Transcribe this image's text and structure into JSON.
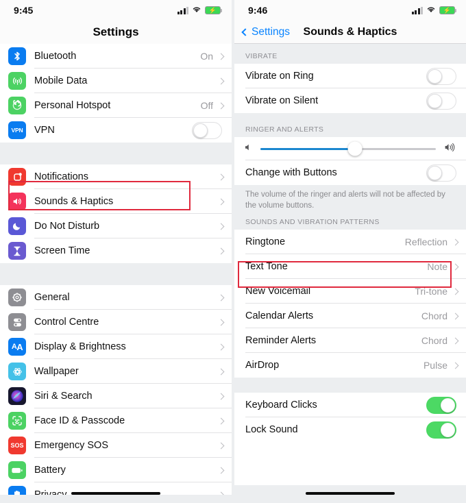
{
  "left": {
    "status": {
      "time": "9:45",
      "signal_icon": "cellular-signal-icon",
      "wifi_icon": "wifi-icon",
      "battery_icon": "battery-charging-icon"
    },
    "nav": {
      "title": "Settings"
    },
    "groups": [
      {
        "items": [
          {
            "label": "Bluetooth",
            "value": "On",
            "icon": "bluetooth-icon",
            "accessory": "chevron",
            "color": "#0a7cf0"
          },
          {
            "label": "Mobile Data",
            "value": "",
            "icon": "mobile-data-icon",
            "accessory": "chevron",
            "color": "#4cd263"
          },
          {
            "label": "Personal Hotspot",
            "value": "Off",
            "icon": "personal-hotspot-icon",
            "accessory": "chevron",
            "color": "#4cd263"
          },
          {
            "label": "VPN",
            "value": "",
            "icon": "vpn-icon",
            "accessory": "toggle",
            "toggle_on": false,
            "color": "#0a7cf0"
          }
        ]
      },
      {
        "items": [
          {
            "label": "Notifications",
            "value": "",
            "icon": "notifications-icon",
            "accessory": "chevron",
            "color": "#f0392f"
          },
          {
            "label": "Sounds & Haptics",
            "value": "",
            "icon": "sounds-haptics-icon",
            "accessory": "chevron",
            "color": "#f4335b"
          },
          {
            "label": "Do Not Disturb",
            "value": "",
            "icon": "do-not-disturb-icon",
            "accessory": "chevron",
            "color": "#5a58d6"
          },
          {
            "label": "Screen Time",
            "value": "",
            "icon": "screen-time-icon",
            "accessory": "chevron",
            "color": "#6a5ad0"
          }
        ]
      },
      {
        "items": [
          {
            "label": "General",
            "value": "",
            "icon": "general-gear-icon",
            "accessory": "chevron",
            "color": "#8e8e93"
          },
          {
            "label": "Control Centre",
            "value": "",
            "icon": "control-centre-icon",
            "accessory": "chevron",
            "color": "#8e8e93"
          },
          {
            "label": "Display & Brightness",
            "value": "",
            "icon": "display-brightness-icon",
            "accessory": "chevron",
            "color": "#0a7cf0"
          },
          {
            "label": "Wallpaper",
            "value": "",
            "icon": "wallpaper-icon",
            "accessory": "chevron",
            "color": "#44c1e8"
          },
          {
            "label": "Siri & Search",
            "value": "",
            "icon": "siri-search-icon",
            "accessory": "chevron",
            "color": "#1d1d38"
          },
          {
            "label": "Face ID & Passcode",
            "value": "",
            "icon": "face-id-icon",
            "accessory": "chevron",
            "color": "#4cd263"
          },
          {
            "label": "Emergency SOS",
            "value": "",
            "icon": "emergency-sos-icon",
            "accessory": "chevron",
            "color": "#f0392f"
          },
          {
            "label": "Battery",
            "value": "",
            "icon": "battery-settings-icon",
            "accessory": "chevron",
            "color": "#4cd263"
          },
          {
            "label": "Privacy",
            "value": "",
            "icon": "privacy-hand-icon",
            "accessory": "chevron",
            "color": "#0a7cf0"
          }
        ]
      }
    ],
    "highlight_target": "Sounds & Haptics"
  },
  "right": {
    "status": {
      "time": "9:46",
      "signal_icon": "cellular-signal-icon",
      "wifi_icon": "wifi-icon",
      "battery_icon": "battery-charging-icon"
    },
    "nav": {
      "back_label": "Settings",
      "title": "Sounds & Haptics",
      "back_icon": "chevron-left-icon"
    },
    "sections": [
      {
        "header": "VIBRATE",
        "rows": [
          {
            "label": "Vibrate on Ring",
            "type": "toggle",
            "on": false
          },
          {
            "label": "Vibrate on Silent",
            "type": "toggle",
            "on": false
          }
        ]
      },
      {
        "header": "RINGER AND ALERTS",
        "rows": [
          {
            "label": "",
            "type": "slider",
            "value_percent": 54,
            "left_icon": "speaker-low-icon",
            "right_icon": "speaker-high-icon"
          },
          {
            "label": "Change with Buttons",
            "type": "toggle",
            "on": false
          }
        ],
        "footnote": "The volume of the ringer and alerts will not be affected by the volume buttons."
      },
      {
        "header": "SOUNDS AND VIBRATION PATTERNS",
        "rows": [
          {
            "label": "Ringtone",
            "type": "value",
            "value": "Reflection"
          },
          {
            "label": "Text Tone",
            "type": "value",
            "value": "Note"
          },
          {
            "label": "New Voicemail",
            "type": "value",
            "value": "Tri-tone"
          },
          {
            "label": "Calendar Alerts",
            "type": "value",
            "value": "Chord"
          },
          {
            "label": "Reminder Alerts",
            "type": "value",
            "value": "Chord"
          },
          {
            "label": "AirDrop",
            "type": "value",
            "value": "Pulse"
          }
        ]
      },
      {
        "header": "",
        "rows": [
          {
            "label": "Keyboard Clicks",
            "type": "toggle",
            "on": true
          },
          {
            "label": "Lock Sound",
            "type": "toggle",
            "on": true
          }
        ]
      }
    ],
    "highlight_target": "Ringtone"
  },
  "colors": {
    "highlight": "#e0293d",
    "accent_blue": "#0a84ff",
    "toggle_on_green": "#4cd964",
    "slider_fill": "#1b87cf",
    "group_bg": "#eceef0"
  }
}
